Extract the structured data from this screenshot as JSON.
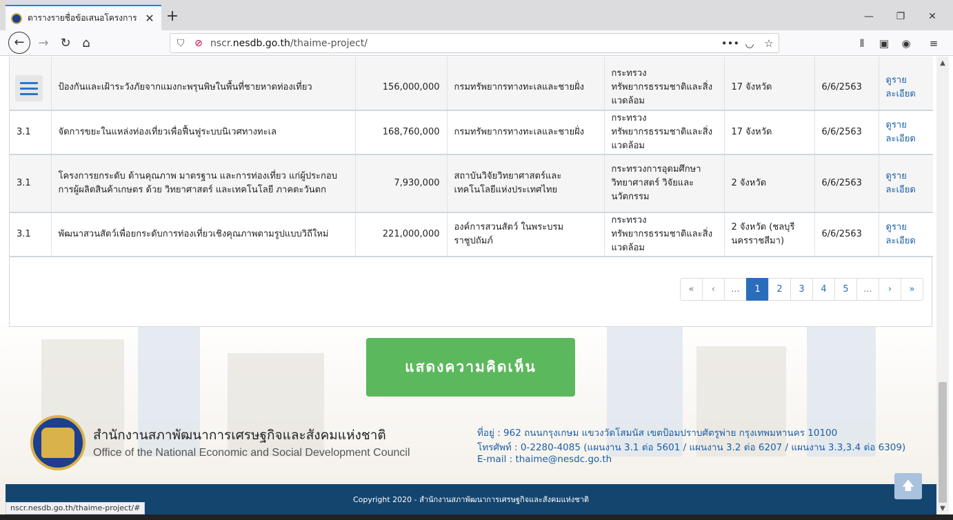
{
  "browser": {
    "tab_title": "ตารางรายชื่อข้อเสนอโครงการ – N",
    "tab_close": "✕",
    "new_tab": "+",
    "url_domain_prefix": "nscr.",
    "url_domain": "nesdb.go.th",
    "url_path": "/thaime-project/",
    "status_url": "nscr.nesdb.go.th/thaime-project/#"
  },
  "table": {
    "rows": [
      {
        "code": "",
        "project": "ป้องกันและเฝ้าระวังภัยจากแมงกะพรุนพิษในพื้นที่ชายหาดท่องเที่ยว",
        "budget": "156,000,000",
        "agency": "กรมทรัพยากรทางทะเลและชายฝั่ง",
        "ministry": "กระทรวงทรัพยากรธรรมชาติและสิ่งแวดล้อม",
        "area": "17 จังหวัด",
        "date": "6/6/2563",
        "link": "ดูรายละเอียด"
      },
      {
        "code": "3.1",
        "project": "จัดการขยะในแหล่งท่องเที่ยวเพื่อฟื้นฟูระบบนิเวศทางทะเล",
        "budget": "168,760,000",
        "agency": "กรมทรัพยากรทางทะเลและชายฝั่ง",
        "ministry": "กระทรวงทรัพยากรธรรมชาติและสิ่งแวดล้อม",
        "area": "17 จังหวัด",
        "date": "6/6/2563",
        "link": "ดูรายละเอียด"
      },
      {
        "code": "3.1",
        "project": "โครงการยกระดับ ด้านคุณภาพ มาตรฐาน และการท่องเที่ยว แก่ผู้ประกอบการผู้ผลิตสินค้าเกษตร ด้วย วิทยาศาสตร์ และเทคโนโลยี ภาคตะวันตก",
        "budget": "7,930,000",
        "agency": "สถาบันวิจัยวิทยาศาสตร์และเทคโนโลยีแห่งประเทศไทย",
        "ministry": "กระทรวงการอุดมศึกษา วิทยาศาสตร์ วิจัยและนวัตกรรม",
        "area": "2 จังหวัด",
        "date": "6/6/2563",
        "link": "ดูรายละเอียด"
      },
      {
        "code": "3.1",
        "project": "พัฒนาสวนสัตว์เพื่อยกระดับการท่องเที่ยวเชิงคุณภาพตามรูปแบบวิถีใหม่",
        "budget": "221,000,000",
        "agency": "องค์การสวนสัตว์ ในพระบรมราชูปถัมภ์",
        "ministry": "กระทรวงทรัพยากรธรรมชาติและสิ่งแวดล้อม",
        "area": "2 จังหวัด (ชลบุรี นครราชสีมา)",
        "date": "6/6/2563",
        "link": "ดูรายละเอียด"
      }
    ]
  },
  "pagination": [
    "«",
    "‹",
    "...",
    "1",
    "2",
    "3",
    "4",
    "5",
    "...",
    "›",
    "»"
  ],
  "pagination_active": "1",
  "cta_label": "แสดงความคิดเห็น",
  "org": {
    "name_th": "สำนักงานสภาพัฒนาการเศรษฐกิจและสังคมแห่งชาติ",
    "name_en": "Office of the National Economic and Social Development Council",
    "address": "ที่อยู่ : 962 ถนนกรุงเกษม แขวงวัดโสมนัส เขตป้อมปราบศัตรูพ่าย กรุงเทพมหานคร 10100",
    "phone": "โทรศัพท์ : 0-2280-4085 (แผนงาน 3.1 ต่อ 5601 / แผนงาน 3.2 ต่อ 6207 / แผนงาน 3.3,3.4 ต่อ 6309)",
    "email": "E-mail : thaime@nesdc.go.th"
  },
  "footer": {
    "copyright": "Copyright 2020 - สำนักงานสภาพัฒนาการเศรษฐกิจและสังคมแห่งชาติ"
  },
  "colors": {
    "accent": "#2a6ebb",
    "cta": "#5cb85c",
    "footer": "#14456f",
    "link": "#1a5fa8"
  }
}
